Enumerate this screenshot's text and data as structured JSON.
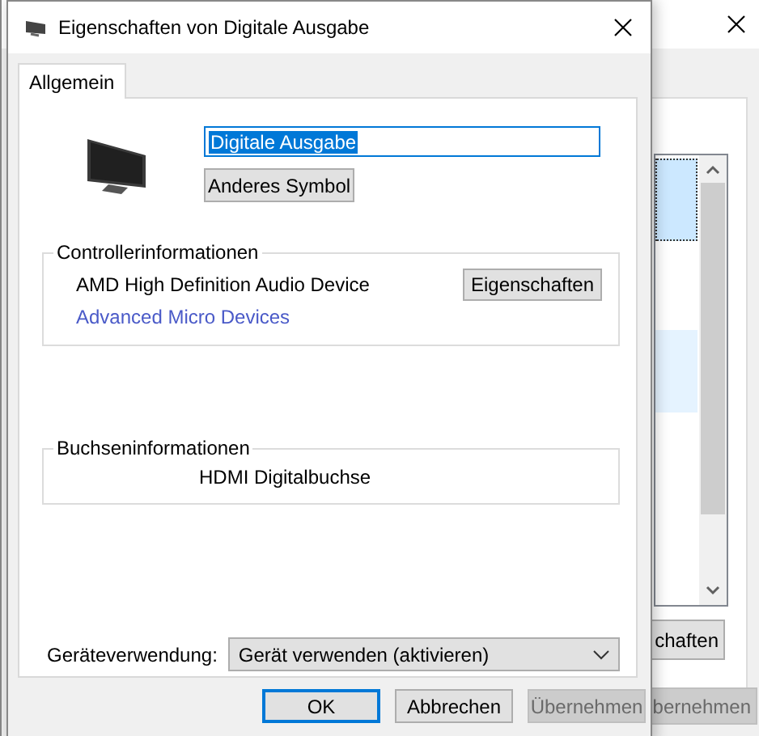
{
  "background_window": {
    "buttons": [
      {
        "label": "chaften",
        "disabled": false
      },
      {
        "label": "bernehmen",
        "disabled": true
      }
    ]
  },
  "dialog": {
    "title": "Eigenschaften von Digitale Ausgabe",
    "tabs": [
      {
        "label": "Allgemein",
        "selected": true
      }
    ],
    "name_field": {
      "value": "Digitale Ausgabe",
      "text_selected": true
    },
    "change_icon_button": "Anderes Symbol",
    "controller_group": {
      "title": "Controllerinformationen",
      "device": "AMD High Definition Audio Device",
      "properties_button": "Eigenschaften",
      "manufacturer_link": "Advanced Micro Devices"
    },
    "jack_group": {
      "title": "Buchseninformationen",
      "jack": "HDMI Digitalbuchse"
    },
    "device_usage": {
      "label": "Geräteverwendung:",
      "value": "Gerät verwenden (aktivieren)"
    },
    "buttons": [
      {
        "label": "OK",
        "default": true,
        "disabled": false
      },
      {
        "label": "Abbrechen",
        "default": false,
        "disabled": false
      },
      {
        "label": "Übernehmen",
        "default": false,
        "disabled": true
      }
    ]
  }
}
